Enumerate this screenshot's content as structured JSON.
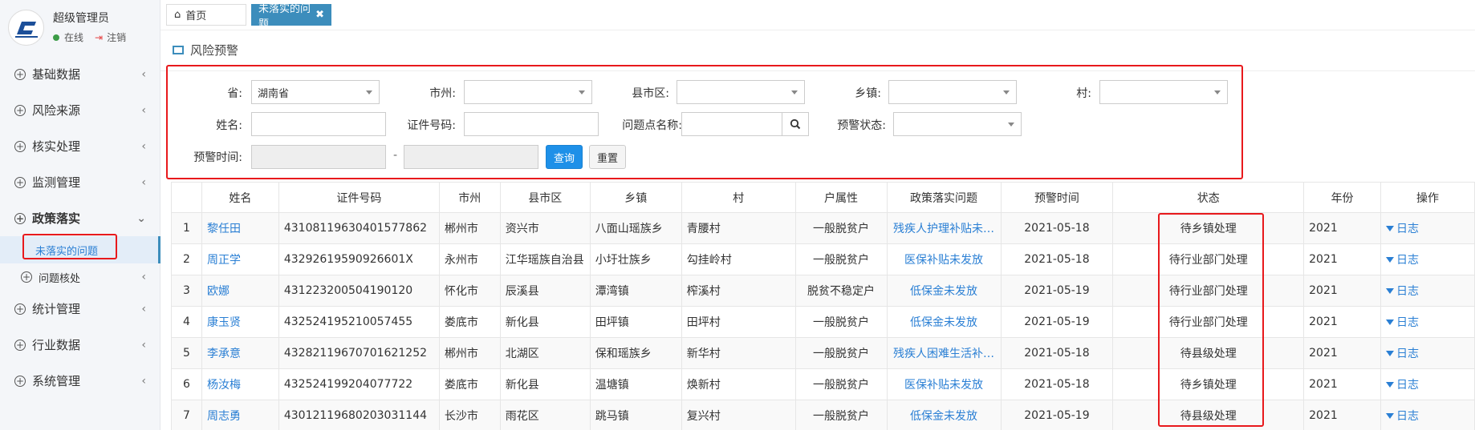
{
  "user": {
    "name": "超级管理员",
    "status": "在线",
    "logout": "注销"
  },
  "sidebar": {
    "items": [
      {
        "label": "基础数据"
      },
      {
        "label": "风险来源"
      },
      {
        "label": "核实处理"
      },
      {
        "label": "监测管理"
      },
      {
        "label": "政策落实"
      },
      {
        "label": "统计管理"
      },
      {
        "label": "行业数据"
      },
      {
        "label": "系统管理"
      }
    ],
    "sub": [
      {
        "label": "未落实的问题"
      },
      {
        "label": "问题核处"
      }
    ]
  },
  "tabs": {
    "home": "首页",
    "active": "未落实的问题"
  },
  "panel": {
    "title": "风险预警"
  },
  "form": {
    "province_label": "省:",
    "province_value": "湖南省",
    "city_label": "市州:",
    "county_label": "县市区:",
    "town_label": "乡镇:",
    "village_label": "村:",
    "name_label": "姓名:",
    "id_label": "证件号码:",
    "issue_label": "问题点名称:",
    "warn_status_label": "预警状态:",
    "warn_time_label": "预警时间:",
    "dash": "-",
    "query_button": "查询",
    "reset_button": "重置"
  },
  "table": {
    "headers": [
      "姓名",
      "证件号码",
      "市州",
      "县市区",
      "乡镇",
      "村",
      "户属性",
      "政策落实问题",
      "预警时间",
      "状态",
      "年份",
      "操作"
    ],
    "log_label": "日志",
    "rows": [
      {
        "idx": "1",
        "name": "黎任田",
        "id": "43108119630401577862",
        "city": "郴州市",
        "county": "资兴市",
        "town": "八面山瑶族乡",
        "village": "青腰村",
        "attr": "一般脱贫户",
        "issue": "残疾人护理补贴未…",
        "time": "2021-05-18",
        "status": "待乡镇处理",
        "year": "2021"
      },
      {
        "idx": "2",
        "name": "周正学",
        "id": "43292619590926601X",
        "city": "永州市",
        "county": "江华瑶族自治县",
        "town": "小圩壮族乡",
        "village": "勾挂岭村",
        "attr": "一般脱贫户",
        "issue": "医保补贴未发放",
        "time": "2021-05-18",
        "status": "待行业部门处理",
        "year": "2021"
      },
      {
        "idx": "3",
        "name": "欧娜",
        "id": "431223200504190120",
        "city": "怀化市",
        "county": "辰溪县",
        "town": "潭湾镇",
        "village": "榨溪村",
        "attr": "脱贫不稳定户",
        "issue": "低保金未发放",
        "time": "2021-05-19",
        "status": "待行业部门处理",
        "year": "2021"
      },
      {
        "idx": "4",
        "name": "康玉贤",
        "id": "432524195210057455",
        "city": "娄底市",
        "county": "新化县",
        "town": "田坪镇",
        "village": "田坪村",
        "attr": "一般脱贫户",
        "issue": "低保金未发放",
        "time": "2021-05-19",
        "status": "待行业部门处理",
        "year": "2021"
      },
      {
        "idx": "5",
        "name": "李承意",
        "id": "43282119670701621252",
        "city": "郴州市",
        "county": "北湖区",
        "town": "保和瑶族乡",
        "village": "新华村",
        "attr": "一般脱贫户",
        "issue": "残疾人困难生活补…",
        "time": "2021-05-18",
        "status": "待县级处理",
        "year": "2021"
      },
      {
        "idx": "6",
        "name": "杨汝梅",
        "id": "432524199204077722",
        "city": "娄底市",
        "county": "新化县",
        "town": "温塘镇",
        "village": "焕新村",
        "attr": "一般脱贫户",
        "issue": "医保补贴未发放",
        "time": "2021-05-18",
        "status": "待乡镇处理",
        "year": "2021"
      },
      {
        "idx": "7",
        "name": "周志勇",
        "id": "43012119680203031144",
        "city": "长沙市",
        "county": "雨花区",
        "town": "跳马镇",
        "village": "复兴村",
        "attr": "一般脱贫户",
        "issue": "低保金未发放",
        "time": "2021-05-19",
        "status": "待县级处理",
        "year": "2021"
      }
    ]
  }
}
